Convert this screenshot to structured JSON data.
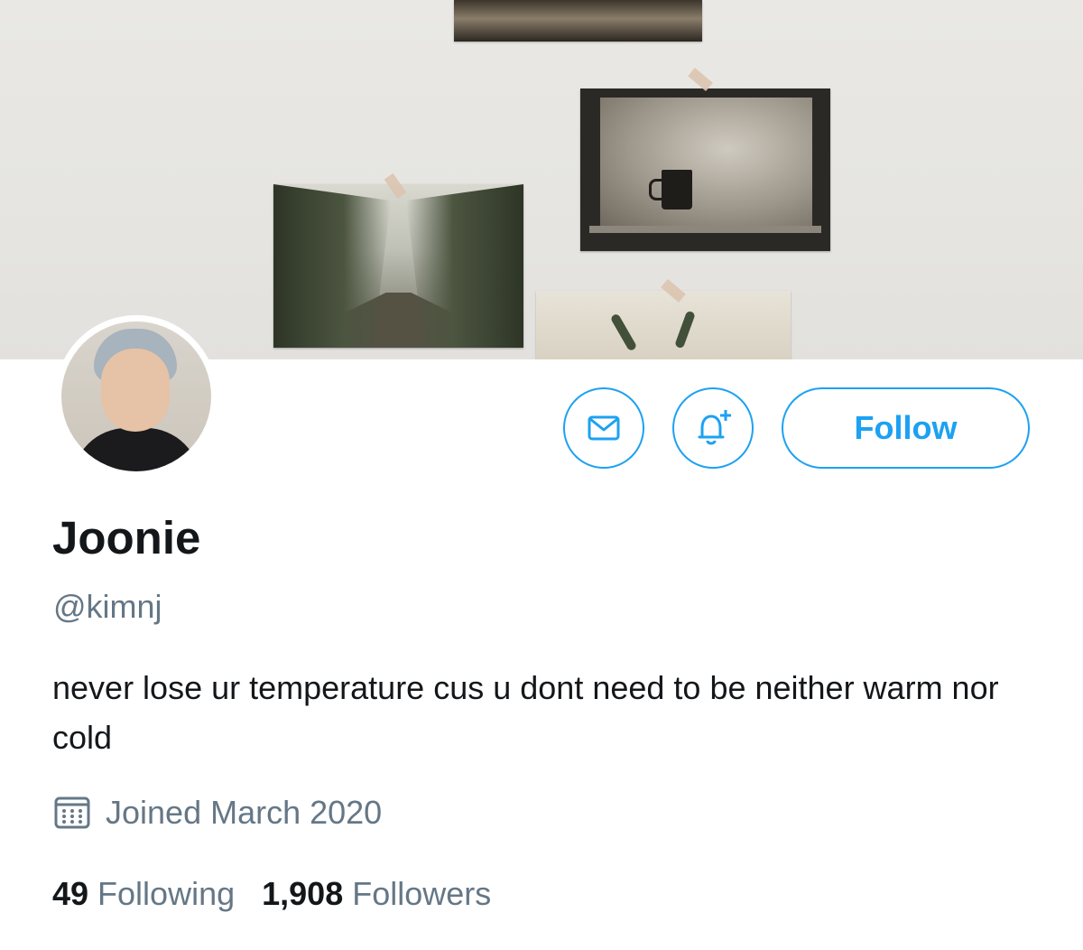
{
  "profile": {
    "display_name": "Joonie",
    "handle": "@kimnj",
    "bio": "never lose ur temperature cus u dont need to be neither warm nor cold",
    "joined": "Joined March 2020"
  },
  "actions": {
    "message_icon": "envelope-icon",
    "notify_icon": "bell-plus-icon",
    "follow_label": "Follow"
  },
  "stats": {
    "following_count": "49",
    "following_label": "Following",
    "followers_count": "1,908",
    "followers_label": "Followers"
  },
  "colors": {
    "accent": "#1da1f2",
    "primary_text": "#14171a",
    "secondary_text": "#657786"
  }
}
